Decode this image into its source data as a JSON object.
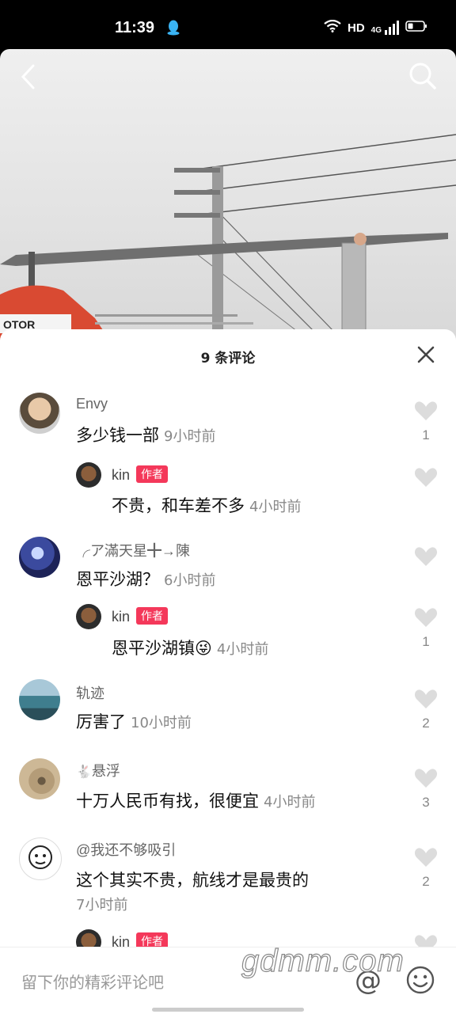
{
  "status": {
    "time": "11:39",
    "hd": "HD",
    "network": "4G"
  },
  "sheet": {
    "title": "9 条评论"
  },
  "comments": [
    {
      "name": "Envy",
      "text": "多少钱一部",
      "time": "9小时前",
      "likes": "1"
    },
    {
      "name": "kin",
      "tag": "作者",
      "text": "不贵，和车差不多",
      "time": "4小时前",
      "likes": ""
    },
    {
      "name": "╭ア滿天星╋→陳",
      "text": "恩平沙湖？",
      "time": "6小时前",
      "likes": ""
    },
    {
      "name": "kin",
      "tag": "作者",
      "text": "恩平沙湖镇😜",
      "time": "4小时前",
      "likes": "1"
    },
    {
      "name": "轨迹",
      "text": "厉害了",
      "time": "10小时前",
      "likes": "2"
    },
    {
      "name": "悬浮",
      "text": "十万人民币有找，很便宜",
      "time": "4小时前",
      "likes": "3"
    },
    {
      "name": "@我还不够吸引",
      "text": "这个其实不贵，航线才是最贵的",
      "time": "7小时前",
      "likes": "2"
    },
    {
      "name": "kin",
      "tag": "作者"
    }
  ],
  "input": {
    "placeholder": "留下你的精彩评论吧",
    "at_symbol": "@"
  },
  "watermark": "gdmm.com",
  "icons": {
    "back": "back-arrow-icon",
    "search": "search-icon",
    "close": "close-icon",
    "like": "heart-icon",
    "emoji": "emoji-icon"
  },
  "colors": {
    "author_tag": "#f4385a",
    "like_gray": "#dcdcdc"
  }
}
